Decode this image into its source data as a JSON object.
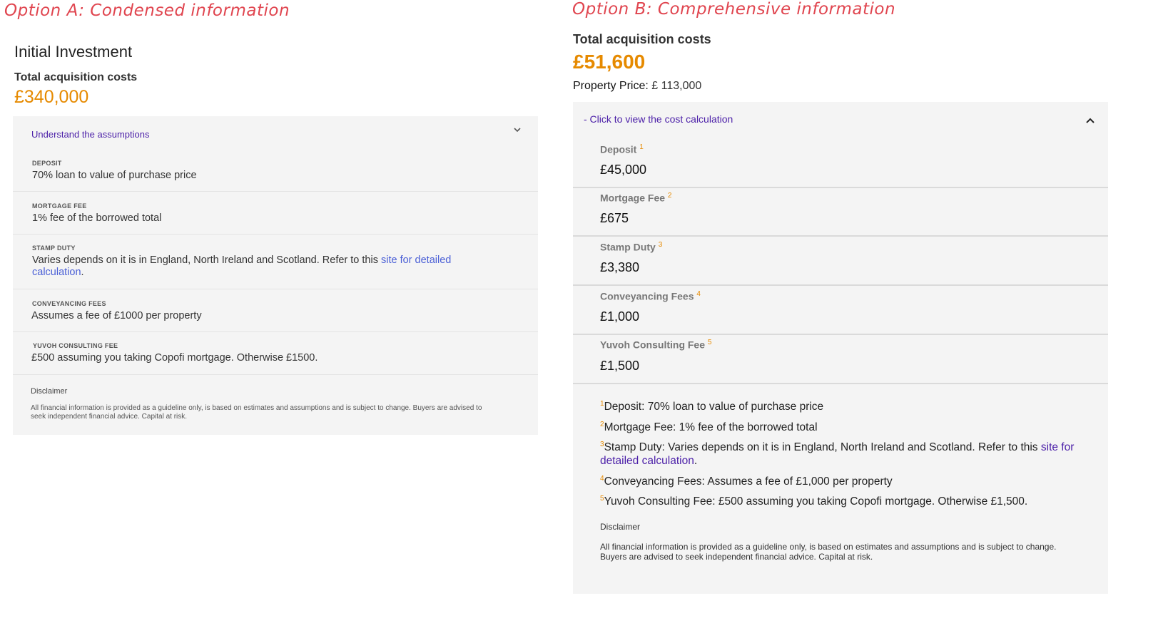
{
  "option_a": {
    "title": "Option A: Condensed information",
    "heading": "Initial Investment",
    "total_label": "Total acquisition costs",
    "total_value": "£340,000",
    "toggle_label": "Understand the assumptions",
    "chevron_icon": "chevron-down-icon",
    "items": [
      {
        "label": "DEPOSIT",
        "text": "70% loan to value of purchase price"
      },
      {
        "label": "MORTGAGE FEE",
        "text": "1% fee of the borrowed total"
      },
      {
        "label": "STAMP DUTY",
        "text": "Varies depends on it is in England, North Ireland and Scotland. Refer to this ",
        "link": "site for detailed calculation",
        "suffix": "."
      },
      {
        "label": "CONVEYANCING FEES",
        "text": "Assumes a fee of £1000 per property"
      },
      {
        "label": "YUVOH CONSULTING FEE",
        "text": "£500 assuming you taking Copofi mortgage. Otherwise £1500."
      }
    ],
    "disclaimer_label": "Disclaimer",
    "disclaimer_text": "All financial information is provided as a guideline only, is based on estimates and assumptions and is subject to change. Buyers are advised to seek independent financial advice. Capital at risk."
  },
  "option_b": {
    "title": "Option B: Comprehensive information",
    "total_label": "Total acquisition costs",
    "total_value": "£51,600",
    "price_label": "Property Price:",
    "price_value": "£ 113,000",
    "toggle_label": "-  Click to view the cost calculation",
    "chevron_icon": "chevron-up-icon",
    "items": [
      {
        "label": "Deposit",
        "num": "1",
        "value": "£45,000"
      },
      {
        "label": "Mortgage Fee",
        "num": "2",
        "value": "£675"
      },
      {
        "label": "Stamp Duty",
        "num": "3",
        "value": "£3,380"
      },
      {
        "label": "Conveyancing Fees",
        "num": "4",
        "value": "£1,000"
      },
      {
        "label": "Yuvoh Consulting Fee",
        "num": "5",
        "value": "£1,500"
      }
    ],
    "notes": [
      {
        "num": "1",
        "text": "Deposit: 70% loan to value of purchase price"
      },
      {
        "num": "2",
        "text": "Mortgage Fee: 1% fee of the borrowed total"
      },
      {
        "num": "3",
        "text": "Stamp Duty: Varies depends on it is in England, North Ireland and Scotland. Refer to this ",
        "link": "site for detailed calculation",
        "suffix": "."
      },
      {
        "num": "4",
        "text": "Conveyancing Fees: Assumes a fee of £1,000 per property"
      },
      {
        "num": "5",
        "text": "Yuvoh Consulting Fee: £500 assuming you taking Copofi mortgage. Otherwise £1,500."
      }
    ],
    "disclaimer_label": "Disclaimer",
    "disclaimer_text": "All financial information is provided as a guideline only, is based on estimates and assumptions and is subject to change. Buyers are advised to seek independent financial advice. Capital at risk."
  },
  "colors": {
    "accent_orange": "#e68a00",
    "title_red": "#e0454f",
    "link_purple": "#4b1fa8",
    "link_blue": "#4a5fd6"
  }
}
